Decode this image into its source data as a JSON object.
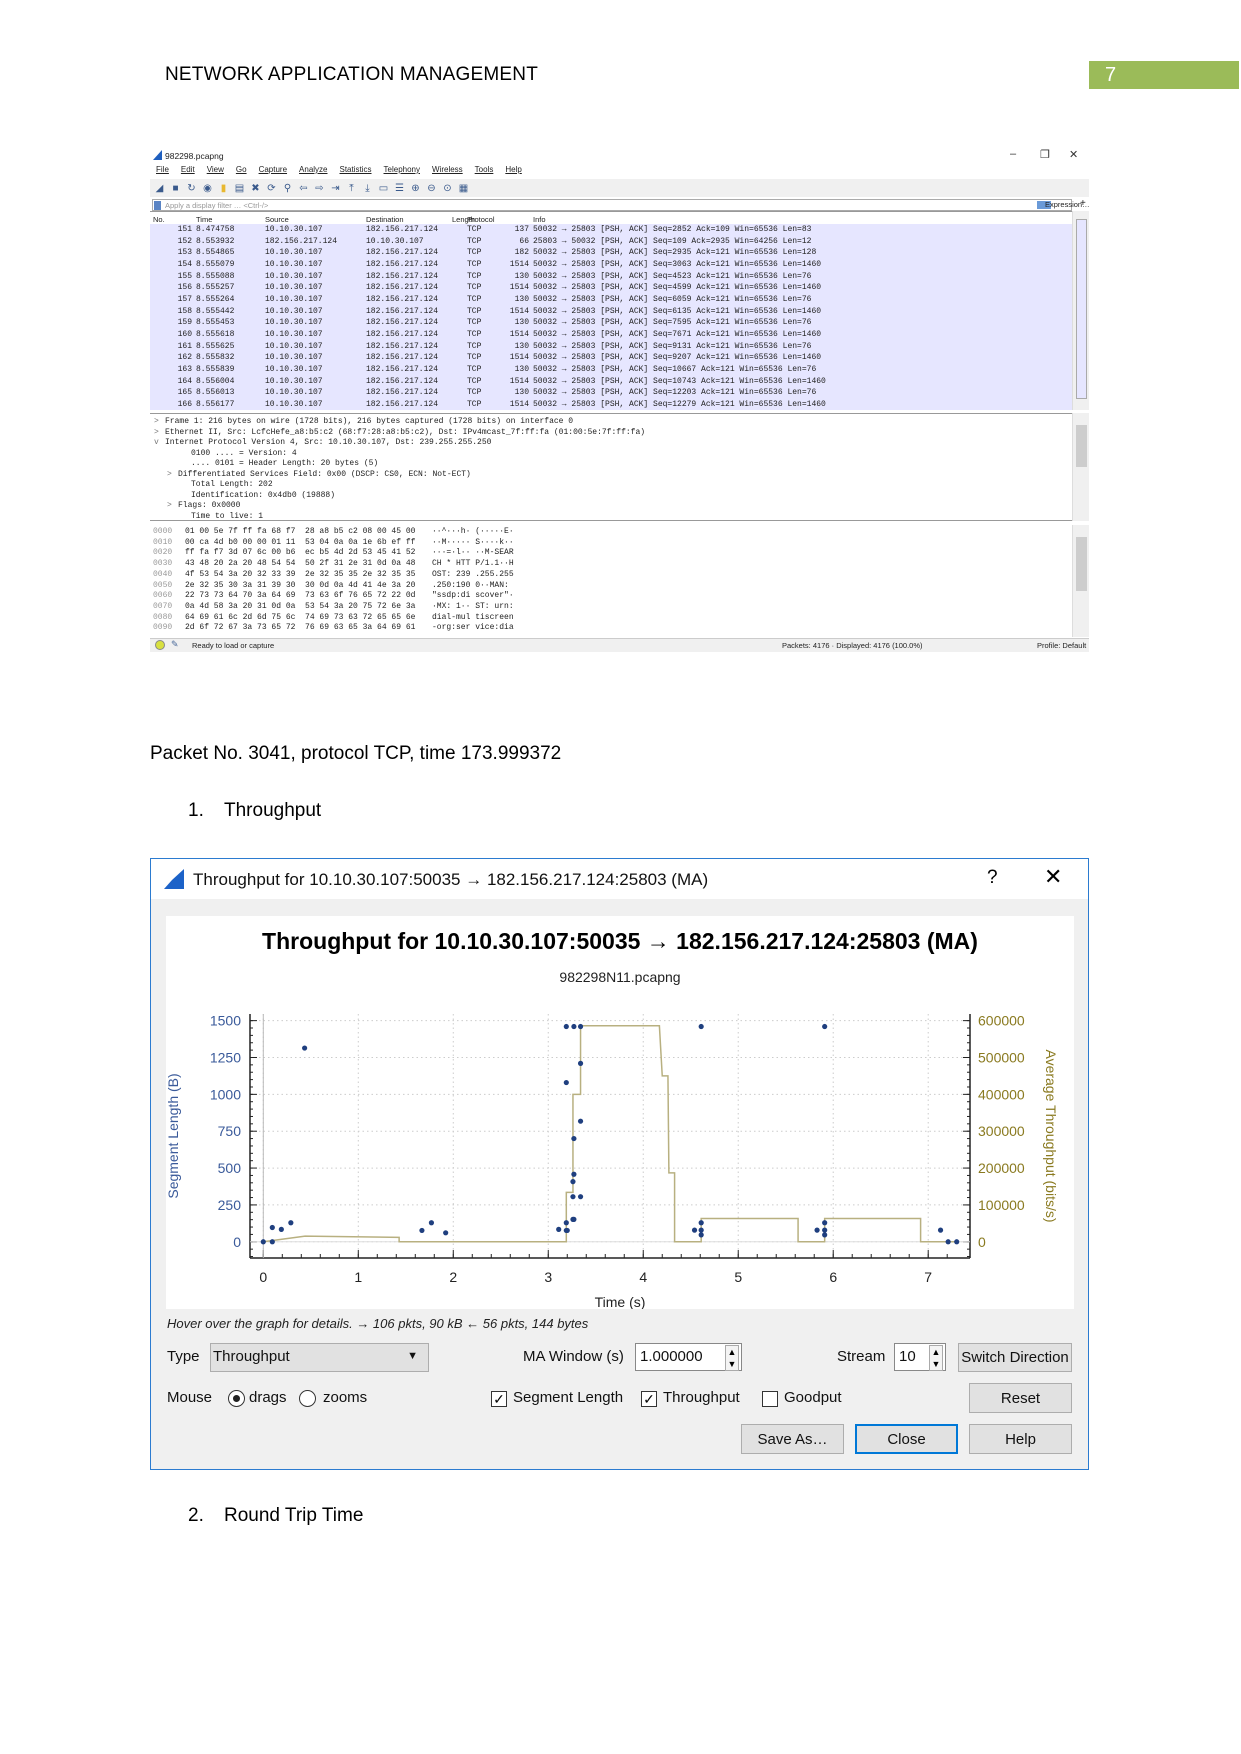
{
  "header": {
    "title": "NETWORK APPLICATION MANAGEMENT",
    "page_number": "7",
    "page_number_bg": "#9bbb59"
  },
  "wireshark": {
    "title": "982298.pcapng",
    "menu": [
      "File",
      "Edit",
      "View",
      "Go",
      "Capture",
      "Analyze",
      "Statistics",
      "Telephony",
      "Wireless",
      "Tools",
      "Help"
    ],
    "filter_placeholder": "Apply a display filter … <Ctrl-/>",
    "expression_label": "Expression…",
    "columns": [
      "No.",
      "Time",
      "Source",
      "Destination",
      "Protocol",
      "Length",
      "Info"
    ],
    "row_bg": "#e6e6ff",
    "packets": [
      [
        "151",
        "8.474758",
        "10.10.30.107",
        "182.156.217.124",
        "TCP",
        "137",
        "50032 → 25803 [PSH, ACK] Seq=2852 Ack=109 Win=65536 Len=83"
      ],
      [
        "152",
        "8.553932",
        "182.156.217.124",
        "10.10.30.107",
        "TCP",
        "66",
        "25803 → 50032 [PSH, ACK] Seq=109 Ack=2935 Win=64256 Len=12"
      ],
      [
        "153",
        "8.554865",
        "10.10.30.107",
        "182.156.217.124",
        "TCP",
        "182",
        "50032 → 25803 [PSH, ACK] Seq=2935 Ack=121 Win=65536 Len=128"
      ],
      [
        "154",
        "8.555079",
        "10.10.30.107",
        "182.156.217.124",
        "TCP",
        "1514",
        "50032 → 25803 [PSH, ACK] Seq=3063 Ack=121 Win=65536 Len=1460"
      ],
      [
        "155",
        "8.555088",
        "10.10.30.107",
        "182.156.217.124",
        "TCP",
        "130",
        "50032 → 25803 [PSH, ACK] Seq=4523 Ack=121 Win=65536 Len=76"
      ],
      [
        "156",
        "8.555257",
        "10.10.30.107",
        "182.156.217.124",
        "TCP",
        "1514",
        "50032 → 25803 [PSH, ACK] Seq=4599 Ack=121 Win=65536 Len=1460"
      ],
      [
        "157",
        "8.555264",
        "10.10.30.107",
        "182.156.217.124",
        "TCP",
        "130",
        "50032 → 25803 [PSH, ACK] Seq=6059 Ack=121 Win=65536 Len=76"
      ],
      [
        "158",
        "8.555442",
        "10.10.30.107",
        "182.156.217.124",
        "TCP",
        "1514",
        "50032 → 25803 [PSH, ACK] Seq=6135 Ack=121 Win=65536 Len=1460"
      ],
      [
        "159",
        "8.555453",
        "10.10.30.107",
        "182.156.217.124",
        "TCP",
        "130",
        "50032 → 25803 [PSH, ACK] Seq=7595 Ack=121 Win=65536 Len=76"
      ],
      [
        "160",
        "8.555618",
        "10.10.30.107",
        "182.156.217.124",
        "TCP",
        "1514",
        "50032 → 25803 [PSH, ACK] Seq=7671 Ack=121 Win=65536 Len=1460"
      ],
      [
        "161",
        "8.555625",
        "10.10.30.107",
        "182.156.217.124",
        "TCP",
        "130",
        "50032 → 25803 [PSH, ACK] Seq=9131 Ack=121 Win=65536 Len=76"
      ],
      [
        "162",
        "8.555832",
        "10.10.30.107",
        "182.156.217.124",
        "TCP",
        "1514",
        "50032 → 25803 [PSH, ACK] Seq=9207 Ack=121 Win=65536 Len=1460"
      ],
      [
        "163",
        "8.555839",
        "10.10.30.107",
        "182.156.217.124",
        "TCP",
        "130",
        "50032 → 25803 [PSH, ACK] Seq=10667 Ack=121 Win=65536 Len=76"
      ],
      [
        "164",
        "8.556004",
        "10.10.30.107",
        "182.156.217.124",
        "TCP",
        "1514",
        "50032 → 25803 [PSH, ACK] Seq=10743 Ack=121 Win=65536 Len=1460"
      ],
      [
        "165",
        "8.556013",
        "10.10.30.107",
        "182.156.217.124",
        "TCP",
        "130",
        "50032 → 25803 [PSH, ACK] Seq=12203 Ack=121 Win=65536 Len=76"
      ],
      [
        "166",
        "8.556177",
        "10.10.30.107",
        "182.156.217.124",
        "TCP",
        "1514",
        "50032 → 25803 [PSH, ACK] Seq=12279 Ack=121 Win=65536 Len=1460"
      ]
    ],
    "details": [
      {
        "arrow": ">",
        "indent": 0,
        "text": "Frame 1: 216 bytes on wire (1728 bits), 216 bytes captured (1728 bits) on interface 0"
      },
      {
        "arrow": ">",
        "indent": 0,
        "text": "Ethernet II, Src: LcfcHefe_a8:b5:c2 (68:f7:28:a8:b5:c2), Dst: IPv4mcast_7f:ff:fa (01:00:5e:7f:ff:fa)"
      },
      {
        "arrow": "v",
        "indent": 0,
        "text": "Internet Protocol Version 4, Src: 10.10.30.107, Dst: 239.255.255.250"
      },
      {
        "arrow": "",
        "indent": 2,
        "text": "0100 .... = Version: 4"
      },
      {
        "arrow": "",
        "indent": 2,
        "text": ".... 0101 = Header Length: 20 bytes (5)"
      },
      {
        "arrow": ">",
        "indent": 1,
        "text": "Differentiated Services Field: 0x00 (DSCP: CS0, ECN: Not-ECT)"
      },
      {
        "arrow": "",
        "indent": 2,
        "text": "Total Length: 202"
      },
      {
        "arrow": "",
        "indent": 2,
        "text": "Identification: 0x4db0 (19888)"
      },
      {
        "arrow": ">",
        "indent": 1,
        "text": "Flags: 0x0000"
      },
      {
        "arrow": "",
        "indent": 2,
        "text": "Time to live: 1"
      }
    ],
    "hex": [
      [
        "0000",
        "01 00 5e 7f ff fa 68 f7  28 a8 b5 c2 08 00 45 00",
        "··^···h· (·····E·"
      ],
      [
        "0010",
        "00 ca 4d b0 00 00 01 11  53 04 0a 0a 1e 6b ef ff",
        "··M····· S····k··"
      ],
      [
        "0020",
        "ff fa f7 3d 07 6c 00 b6  ec b5 4d 2d 53 45 41 52",
        "···=·l·· ··M-SEAR"
      ],
      [
        "0030",
        "43 48 20 2a 20 48 54 54  50 2f 31 2e 31 0d 0a 48",
        "CH * HTT P/1.1··H"
      ],
      [
        "0040",
        "4f 53 54 3a 20 32 33 39  2e 32 35 35 2e 32 35 35",
        "OST: 239 .255.255"
      ],
      [
        "0050",
        "2e 32 35 30 3a 31 39 30  30 0d 0a 4d 41 4e 3a 20",
        ".250:190 0··MAN: "
      ],
      [
        "0060",
        "22 73 73 64 70 3a 64 69  73 63 6f 76 65 72 22 0d",
        "\"ssdp:di scover\"·"
      ],
      [
        "0070",
        "0a 4d 58 3a 20 31 0d 0a  53 54 3a 20 75 72 6e 3a",
        "·MX: 1·· ST: urn:"
      ],
      [
        "0080",
        "64 69 61 6c 2d 6d 75 6c  74 69 73 63 72 65 65 6e",
        "dial-mul tiscreen"
      ],
      [
        "0090",
        "2d 6f 72 67 3a 73 65 72  76 69 63 65 3a 64 69 61",
        "-org:ser vice:dia"
      ]
    ],
    "status": {
      "ready": "Ready to load or capture",
      "packets": "Packets: 4176 · Displayed: 4176 (100.0%)",
      "profile": "Profile: Default"
    }
  },
  "body": {
    "packet_line": "Packet No. 3041, protocol TCP, time 173.999372",
    "item1": {
      "num": "1.",
      "label": "Throughput"
    },
    "item2": {
      "num": "2.",
      "label": "Round Trip Time"
    }
  },
  "dialog": {
    "title": "Throughput for 10.10.30.107:50035 → 182.156.217.124:25803 (MA)",
    "hover_text": "Hover over the graph for details. → 106 pkts, 90 kB ← 56 pkts, 144 bytes",
    "type_label": "Type",
    "type_value": "Throughput",
    "ma_label": "MA Window (s)",
    "ma_value": "1.000000",
    "stream_label": "Stream",
    "stream_value": "10",
    "switch_direction": "Switch Direction",
    "mouse_label": "Mouse",
    "mouse_drags": "drags",
    "mouse_zooms": "zooms",
    "mouse_selected": "drags",
    "checks": [
      {
        "label": "Segment Length",
        "checked": true
      },
      {
        "label": "Throughput",
        "checked": true
      },
      {
        "label": "Goodput",
        "checked": false
      }
    ],
    "reset": "Reset",
    "save_as": "Save As…",
    "close": "Close",
    "help": "Help"
  },
  "chart_data": {
    "type": "scatter",
    "title": "Throughput for 10.10.30.107:50035 → 182.156.217.124:25803 (MA)",
    "subtitle": "982298N11.pcapng",
    "xlabel": "Time (s)",
    "ylabel": "Segment Length (B)",
    "y2label": "Average Throughput (bits/s)",
    "xlim": [
      -0.14,
      7.44
    ],
    "ylim": [
      -110,
      1545
    ],
    "y2lim": [
      -44000,
      618000
    ],
    "xticks": [
      0,
      1,
      2,
      3,
      4,
      5,
      6,
      7
    ],
    "yticks": [
      0,
      250,
      500,
      750,
      1000,
      1250,
      1500
    ],
    "y2ticks": [
      0,
      100000,
      200000,
      300000,
      400000,
      500000,
      600000
    ],
    "grid": true,
    "colors": {
      "segment": "#1f3f7f",
      "throughput": "#b8b080",
      "left_axis_text": "#3a5a9a",
      "right_axis_text": "#8a7a20"
    },
    "series": [
      {
        "name": "Segment Length",
        "axis": "left",
        "style": "points",
        "points": [
          [
            0,
            0
          ],
          [
            0.095,
            0
          ],
          [
            0.095,
            97
          ],
          [
            0.19,
            84
          ],
          [
            0.29,
            129
          ],
          [
            0.435,
            1314
          ],
          [
            1.67,
            77
          ],
          [
            1.77,
            129
          ],
          [
            1.92,
            61
          ],
          [
            3.11,
            84
          ],
          [
            3.19,
            77
          ],
          [
            3.2,
            77
          ],
          [
            3.19,
            129
          ],
          [
            3.19,
            1080
          ],
          [
            3.19,
            1460
          ],
          [
            3.27,
            1460
          ],
          [
            3.34,
            1460
          ],
          [
            3.34,
            1210
          ],
          [
            3.34,
            818
          ],
          [
            3.27,
            700
          ],
          [
            3.27,
            458
          ],
          [
            3.26,
            408
          ],
          [
            3.26,
            306
          ],
          [
            3.34,
            306
          ],
          [
            3.26,
            152
          ],
          [
            3.27,
            152
          ],
          [
            4.61,
            1460
          ],
          [
            4.54,
            79
          ],
          [
            4.61,
            129
          ],
          [
            4.61,
            79
          ],
          [
            4.61,
            47
          ],
          [
            5.91,
            1460
          ],
          [
            5.83,
            79
          ],
          [
            5.91,
            129
          ],
          [
            5.91,
            79
          ],
          [
            5.91,
            47
          ],
          [
            7.13,
            79
          ],
          [
            7.21,
            0
          ],
          [
            7.3,
            0
          ]
        ]
      },
      {
        "name": "Throughput",
        "axis": "right",
        "style": "step",
        "points": [
          [
            0,
            0
          ],
          [
            0.44,
            15400
          ],
          [
            1.43,
            12000
          ],
          [
            1.43,
            0
          ],
          [
            3.19,
            0
          ],
          [
            3.19,
            134000
          ],
          [
            3.26,
            134000
          ],
          [
            3.26,
            400000
          ],
          [
            3.34,
            400000
          ],
          [
            3.34,
            586000
          ],
          [
            4.17,
            586000
          ],
          [
            4.2,
            450000
          ],
          [
            4.26,
            450000
          ],
          [
            4.27,
            187000
          ],
          [
            4.33,
            187000
          ],
          [
            4.33,
            0
          ],
          [
            4.61,
            0
          ],
          [
            4.61,
            63000
          ],
          [
            5.63,
            63000
          ],
          [
            5.63,
            0
          ],
          [
            5.91,
            0
          ],
          [
            5.91,
            63000
          ],
          [
            6.92,
            63000
          ],
          [
            6.92,
            0
          ],
          [
            7.3,
            0
          ]
        ]
      }
    ]
  }
}
